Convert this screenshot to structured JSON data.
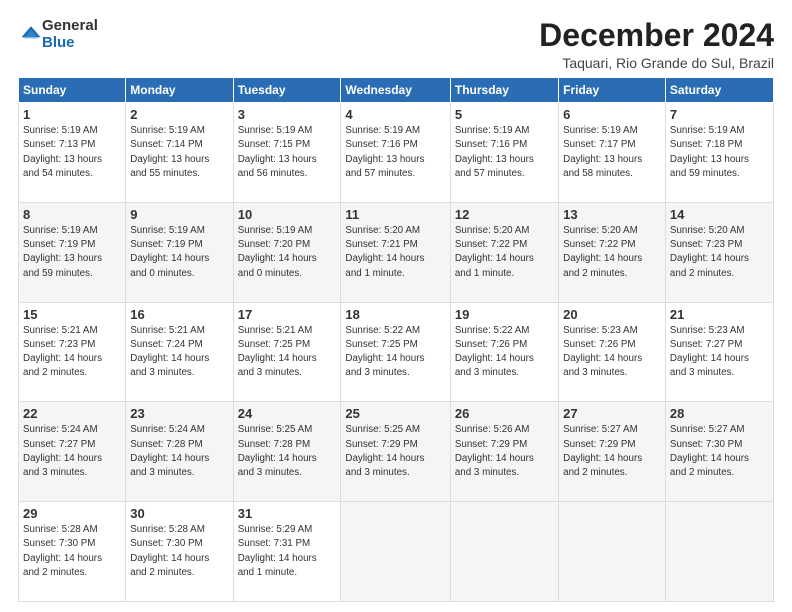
{
  "logo": {
    "general": "General",
    "blue": "Blue"
  },
  "title": "December 2024",
  "location": "Taquari, Rio Grande do Sul, Brazil",
  "days_of_week": [
    "Sunday",
    "Monday",
    "Tuesday",
    "Wednesday",
    "Thursday",
    "Friday",
    "Saturday"
  ],
  "weeks": [
    [
      {
        "day": 1,
        "info": "Sunrise: 5:19 AM\nSunset: 7:13 PM\nDaylight: 13 hours\nand 54 minutes."
      },
      {
        "day": 2,
        "info": "Sunrise: 5:19 AM\nSunset: 7:14 PM\nDaylight: 13 hours\nand 55 minutes."
      },
      {
        "day": 3,
        "info": "Sunrise: 5:19 AM\nSunset: 7:15 PM\nDaylight: 13 hours\nand 56 minutes."
      },
      {
        "day": 4,
        "info": "Sunrise: 5:19 AM\nSunset: 7:16 PM\nDaylight: 13 hours\nand 57 minutes."
      },
      {
        "day": 5,
        "info": "Sunrise: 5:19 AM\nSunset: 7:16 PM\nDaylight: 13 hours\nand 57 minutes."
      },
      {
        "day": 6,
        "info": "Sunrise: 5:19 AM\nSunset: 7:17 PM\nDaylight: 13 hours\nand 58 minutes."
      },
      {
        "day": 7,
        "info": "Sunrise: 5:19 AM\nSunset: 7:18 PM\nDaylight: 13 hours\nand 59 minutes."
      }
    ],
    [
      {
        "day": 8,
        "info": "Sunrise: 5:19 AM\nSunset: 7:19 PM\nDaylight: 13 hours\nand 59 minutes."
      },
      {
        "day": 9,
        "info": "Sunrise: 5:19 AM\nSunset: 7:19 PM\nDaylight: 14 hours\nand 0 minutes."
      },
      {
        "day": 10,
        "info": "Sunrise: 5:19 AM\nSunset: 7:20 PM\nDaylight: 14 hours\nand 0 minutes."
      },
      {
        "day": 11,
        "info": "Sunrise: 5:20 AM\nSunset: 7:21 PM\nDaylight: 14 hours\nand 1 minute."
      },
      {
        "day": 12,
        "info": "Sunrise: 5:20 AM\nSunset: 7:22 PM\nDaylight: 14 hours\nand 1 minute."
      },
      {
        "day": 13,
        "info": "Sunrise: 5:20 AM\nSunset: 7:22 PM\nDaylight: 14 hours\nand 2 minutes."
      },
      {
        "day": 14,
        "info": "Sunrise: 5:20 AM\nSunset: 7:23 PM\nDaylight: 14 hours\nand 2 minutes."
      }
    ],
    [
      {
        "day": 15,
        "info": "Sunrise: 5:21 AM\nSunset: 7:23 PM\nDaylight: 14 hours\nand 2 minutes."
      },
      {
        "day": 16,
        "info": "Sunrise: 5:21 AM\nSunset: 7:24 PM\nDaylight: 14 hours\nand 3 minutes."
      },
      {
        "day": 17,
        "info": "Sunrise: 5:21 AM\nSunset: 7:25 PM\nDaylight: 14 hours\nand 3 minutes."
      },
      {
        "day": 18,
        "info": "Sunrise: 5:22 AM\nSunset: 7:25 PM\nDaylight: 14 hours\nand 3 minutes."
      },
      {
        "day": 19,
        "info": "Sunrise: 5:22 AM\nSunset: 7:26 PM\nDaylight: 14 hours\nand 3 minutes."
      },
      {
        "day": 20,
        "info": "Sunrise: 5:23 AM\nSunset: 7:26 PM\nDaylight: 14 hours\nand 3 minutes."
      },
      {
        "day": 21,
        "info": "Sunrise: 5:23 AM\nSunset: 7:27 PM\nDaylight: 14 hours\nand 3 minutes."
      }
    ],
    [
      {
        "day": 22,
        "info": "Sunrise: 5:24 AM\nSunset: 7:27 PM\nDaylight: 14 hours\nand 3 minutes."
      },
      {
        "day": 23,
        "info": "Sunrise: 5:24 AM\nSunset: 7:28 PM\nDaylight: 14 hours\nand 3 minutes."
      },
      {
        "day": 24,
        "info": "Sunrise: 5:25 AM\nSunset: 7:28 PM\nDaylight: 14 hours\nand 3 minutes."
      },
      {
        "day": 25,
        "info": "Sunrise: 5:25 AM\nSunset: 7:29 PM\nDaylight: 14 hours\nand 3 minutes."
      },
      {
        "day": 26,
        "info": "Sunrise: 5:26 AM\nSunset: 7:29 PM\nDaylight: 14 hours\nand 3 minutes."
      },
      {
        "day": 27,
        "info": "Sunrise: 5:27 AM\nSunset: 7:29 PM\nDaylight: 14 hours\nand 2 minutes."
      },
      {
        "day": 28,
        "info": "Sunrise: 5:27 AM\nSunset: 7:30 PM\nDaylight: 14 hours\nand 2 minutes."
      }
    ],
    [
      {
        "day": 29,
        "info": "Sunrise: 5:28 AM\nSunset: 7:30 PM\nDaylight: 14 hours\nand 2 minutes."
      },
      {
        "day": 30,
        "info": "Sunrise: 5:28 AM\nSunset: 7:30 PM\nDaylight: 14 hours\nand 2 minutes."
      },
      {
        "day": 31,
        "info": "Sunrise: 5:29 AM\nSunset: 7:31 PM\nDaylight: 14 hours\nand 1 minute."
      },
      {
        "day": null,
        "info": ""
      },
      {
        "day": null,
        "info": ""
      },
      {
        "day": null,
        "info": ""
      },
      {
        "day": null,
        "info": ""
      }
    ]
  ]
}
